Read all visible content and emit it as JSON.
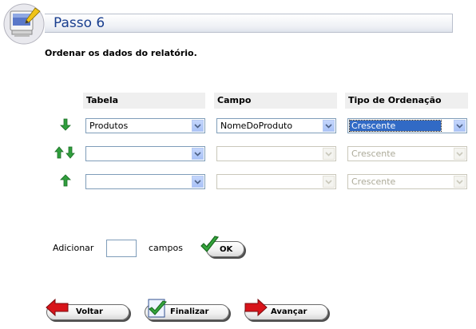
{
  "header": {
    "title": "Passo 6"
  },
  "subtitle": "Ordenar os dados do relatório.",
  "columns": {
    "table": "Tabela",
    "field": "Campo",
    "order": "Tipo de Ordenação"
  },
  "rows": [
    {
      "arrow": "arrow-down",
      "table_value": "Produtos",
      "field_value": "NomeDoProduto",
      "order_value": "Crescente",
      "order_enabled": true
    },
    {
      "arrow": "arrow-up-down",
      "table_value": "",
      "field_value": "",
      "order_value": "Crescente",
      "order_enabled": false
    },
    {
      "arrow": "arrow-up",
      "table_value": "",
      "field_value": "",
      "order_value": "Crescente",
      "order_enabled": false
    }
  ],
  "add_fields": {
    "prefix": "Adicionar",
    "value": "",
    "suffix": "campos",
    "ok_label": "OK"
  },
  "nav": {
    "back": "Voltar",
    "finish": "Finalizar",
    "next": "Avançar"
  },
  "colors": {
    "title": "#1a3f8f",
    "arrow_green": "#2f9e3c",
    "arrow_red": "#d8141a",
    "select_highlight": "#316ac5"
  }
}
